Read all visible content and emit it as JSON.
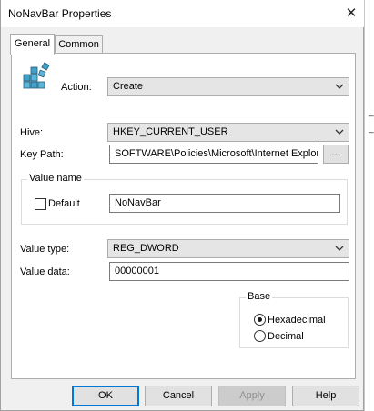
{
  "window": {
    "title": "NoNavBar Properties"
  },
  "tabs": [
    {
      "label": "General",
      "active": true
    },
    {
      "label": "Common",
      "active": false
    }
  ],
  "general": {
    "action": {
      "label": "Action:",
      "value": "Create"
    },
    "hive": {
      "label": "Hive:",
      "value": "HKEY_CURRENT_USER"
    },
    "key_path": {
      "label": "Key Path:",
      "value": "SOFTWARE\\Policies\\Microsoft\\Internet Explorer",
      "browse_label": "..."
    },
    "value_name": {
      "group_label": "Value name",
      "default_label": "Default",
      "default_checked": false,
      "value": "NoNavBar"
    },
    "value_type": {
      "label": "Value type:",
      "value": "REG_DWORD"
    },
    "value_data": {
      "label": "Value data:",
      "value": "00000001"
    },
    "base": {
      "group_label": "Base",
      "options": [
        "Hexadecimal",
        "Decimal"
      ],
      "selected": "Hexadecimal"
    }
  },
  "buttons": {
    "ok": "OK",
    "cancel": "Cancel",
    "apply": "Apply",
    "help": "Help"
  },
  "background_window": {
    "peek_lines": [
      "_C",
      "_C"
    ]
  }
}
